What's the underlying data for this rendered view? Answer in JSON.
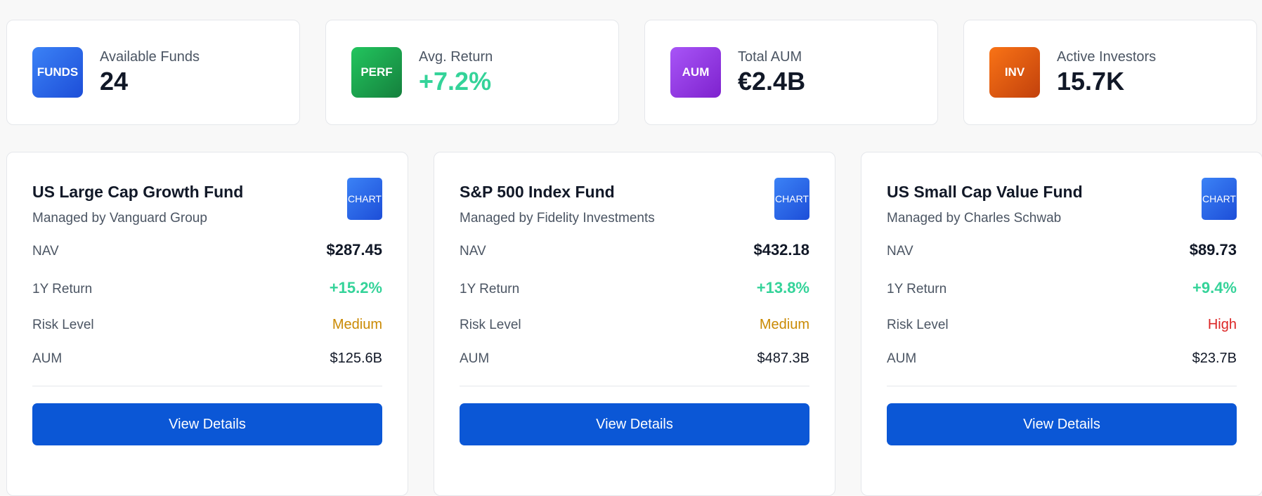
{
  "stats": [
    {
      "icon_text": "FUNDS",
      "label": "Available Funds",
      "value": "24",
      "color": "#2563eb",
      "positive": false
    },
    {
      "icon_text": "PERF",
      "label": "Avg. Return",
      "value": "+7.2%",
      "color": "#16a34a",
      "positive": true
    },
    {
      "icon_text": "AUM",
      "label": "Total AUM",
      "value": "€2.4B",
      "color": "#9333ea",
      "positive": false
    },
    {
      "icon_text": "INV",
      "label": "Active Investors",
      "value": "15.7K",
      "color": "#ea580c",
      "positive": false
    }
  ],
  "funds": [
    {
      "name": "US Large Cap Growth Fund",
      "manager": "Managed by Vanguard Group",
      "icon_text": "CHART",
      "nav_label": "NAV",
      "nav": "$287.45",
      "return_label": "1Y Return",
      "return": "+15.2%",
      "risk_label": "Risk Level",
      "risk": "Medium",
      "risk_color": "#ca8a04",
      "aum_label": "AUM",
      "aum": "$125.6B",
      "button": "View Details"
    },
    {
      "name": "S&P 500 Index Fund",
      "manager": "Managed by Fidelity Investments",
      "icon_text": "CHART",
      "nav_label": "NAV",
      "nav": "$432.18",
      "return_label": "1Y Return",
      "return": "+13.8%",
      "risk_label": "Risk Level",
      "risk": "Medium",
      "risk_color": "#ca8a04",
      "aum_label": "AUM",
      "aum": "$487.3B",
      "button": "View Details"
    },
    {
      "name": "US Small Cap Value Fund",
      "manager": "Managed by Charles Schwab",
      "icon_text": "CHART",
      "nav_label": "NAV",
      "nav": "$89.73",
      "return_label": "1Y Return",
      "return": "+9.4%",
      "risk_label": "Risk Level",
      "risk": "High",
      "risk_color": "#dc2626",
      "aum_label": "AUM",
      "aum": "$23.7B",
      "button": "View Details"
    }
  ]
}
